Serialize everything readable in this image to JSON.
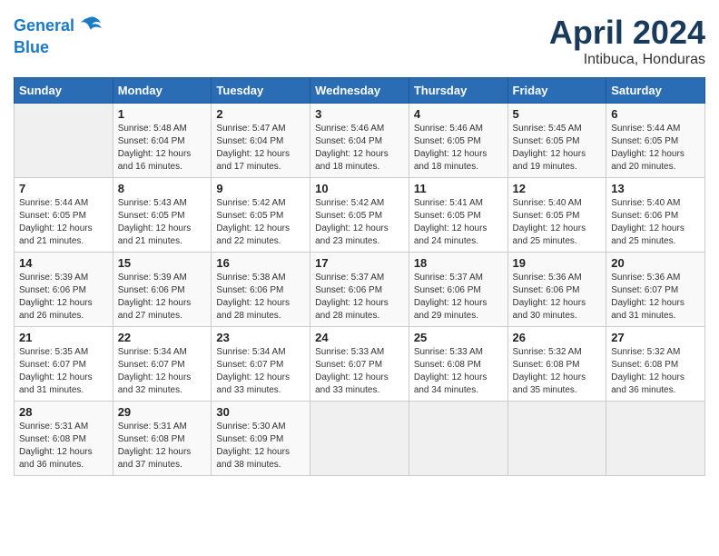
{
  "header": {
    "logo_line1": "General",
    "logo_line2": "Blue",
    "month_title": "April 2024",
    "subtitle": "Intibuca, Honduras"
  },
  "weekdays": [
    "Sunday",
    "Monday",
    "Tuesday",
    "Wednesday",
    "Thursday",
    "Friday",
    "Saturday"
  ],
  "weeks": [
    [
      {
        "day": null
      },
      {
        "day": "1",
        "sunrise": "5:48 AM",
        "sunset": "6:04 PM",
        "daylight": "12 hours and 16 minutes."
      },
      {
        "day": "2",
        "sunrise": "5:47 AM",
        "sunset": "6:04 PM",
        "daylight": "12 hours and 17 minutes."
      },
      {
        "day": "3",
        "sunrise": "5:46 AM",
        "sunset": "6:04 PM",
        "daylight": "12 hours and 18 minutes."
      },
      {
        "day": "4",
        "sunrise": "5:46 AM",
        "sunset": "6:05 PM",
        "daylight": "12 hours and 18 minutes."
      },
      {
        "day": "5",
        "sunrise": "5:45 AM",
        "sunset": "6:05 PM",
        "daylight": "12 hours and 19 minutes."
      },
      {
        "day": "6",
        "sunrise": "5:44 AM",
        "sunset": "6:05 PM",
        "daylight": "12 hours and 20 minutes."
      }
    ],
    [
      {
        "day": "7",
        "sunrise": "5:44 AM",
        "sunset": "6:05 PM",
        "daylight": "12 hours and 21 minutes."
      },
      {
        "day": "8",
        "sunrise": "5:43 AM",
        "sunset": "6:05 PM",
        "daylight": "12 hours and 21 minutes."
      },
      {
        "day": "9",
        "sunrise": "5:42 AM",
        "sunset": "6:05 PM",
        "daylight": "12 hours and 22 minutes."
      },
      {
        "day": "10",
        "sunrise": "5:42 AM",
        "sunset": "6:05 PM",
        "daylight": "12 hours and 23 minutes."
      },
      {
        "day": "11",
        "sunrise": "5:41 AM",
        "sunset": "6:05 PM",
        "daylight": "12 hours and 24 minutes."
      },
      {
        "day": "12",
        "sunrise": "5:40 AM",
        "sunset": "6:05 PM",
        "daylight": "12 hours and 25 minutes."
      },
      {
        "day": "13",
        "sunrise": "5:40 AM",
        "sunset": "6:06 PM",
        "daylight": "12 hours and 25 minutes."
      }
    ],
    [
      {
        "day": "14",
        "sunrise": "5:39 AM",
        "sunset": "6:06 PM",
        "daylight": "12 hours and 26 minutes."
      },
      {
        "day": "15",
        "sunrise": "5:39 AM",
        "sunset": "6:06 PM",
        "daylight": "12 hours and 27 minutes."
      },
      {
        "day": "16",
        "sunrise": "5:38 AM",
        "sunset": "6:06 PM",
        "daylight": "12 hours and 28 minutes."
      },
      {
        "day": "17",
        "sunrise": "5:37 AM",
        "sunset": "6:06 PM",
        "daylight": "12 hours and 28 minutes."
      },
      {
        "day": "18",
        "sunrise": "5:37 AM",
        "sunset": "6:06 PM",
        "daylight": "12 hours and 29 minutes."
      },
      {
        "day": "19",
        "sunrise": "5:36 AM",
        "sunset": "6:06 PM",
        "daylight": "12 hours and 30 minutes."
      },
      {
        "day": "20",
        "sunrise": "5:36 AM",
        "sunset": "6:07 PM",
        "daylight": "12 hours and 31 minutes."
      }
    ],
    [
      {
        "day": "21",
        "sunrise": "5:35 AM",
        "sunset": "6:07 PM",
        "daylight": "12 hours and 31 minutes."
      },
      {
        "day": "22",
        "sunrise": "5:34 AM",
        "sunset": "6:07 PM",
        "daylight": "12 hours and 32 minutes."
      },
      {
        "day": "23",
        "sunrise": "5:34 AM",
        "sunset": "6:07 PM",
        "daylight": "12 hours and 33 minutes."
      },
      {
        "day": "24",
        "sunrise": "5:33 AM",
        "sunset": "6:07 PM",
        "daylight": "12 hours and 33 minutes."
      },
      {
        "day": "25",
        "sunrise": "5:33 AM",
        "sunset": "6:08 PM",
        "daylight": "12 hours and 34 minutes."
      },
      {
        "day": "26",
        "sunrise": "5:32 AM",
        "sunset": "6:08 PM",
        "daylight": "12 hours and 35 minutes."
      },
      {
        "day": "27",
        "sunrise": "5:32 AM",
        "sunset": "6:08 PM",
        "daylight": "12 hours and 36 minutes."
      }
    ],
    [
      {
        "day": "28",
        "sunrise": "5:31 AM",
        "sunset": "6:08 PM",
        "daylight": "12 hours and 36 minutes."
      },
      {
        "day": "29",
        "sunrise": "5:31 AM",
        "sunset": "6:08 PM",
        "daylight": "12 hours and 37 minutes."
      },
      {
        "day": "30",
        "sunrise": "5:30 AM",
        "sunset": "6:09 PM",
        "daylight": "12 hours and 38 minutes."
      },
      {
        "day": null
      },
      {
        "day": null
      },
      {
        "day": null
      },
      {
        "day": null
      }
    ]
  ]
}
